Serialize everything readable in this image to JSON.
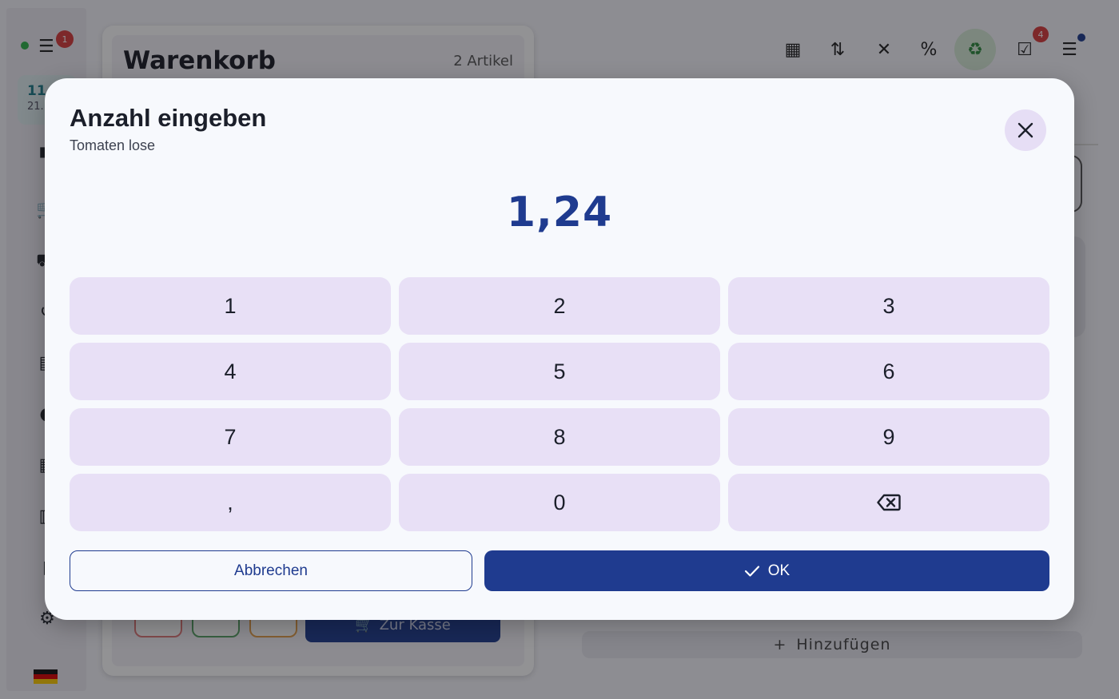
{
  "background": {
    "rail": {
      "menu_badge": "1",
      "time": "11",
      "date": "21.",
      "nav_icons": [
        "dashboard-icon",
        "cart-icon",
        "scooter-icon",
        "history-icon",
        "store-icon",
        "person-icon",
        "calendar-icon",
        "receipt-icon",
        "report-icon",
        "gear-icon"
      ]
    },
    "cart": {
      "title": "Warenkorb",
      "count": "2 Artikel",
      "checkout_label": "Zur Kasse"
    },
    "toolbar": {
      "tasks_badge": "4"
    },
    "add_label": "Hinzufügen"
  },
  "dialog": {
    "title": "Anzahl eingeben",
    "subtitle": "Tomaten lose",
    "value": "1,24",
    "keys": [
      "1",
      "2",
      "3",
      "4",
      "5",
      "6",
      "7",
      "8",
      "9",
      ",",
      "0"
    ],
    "backspace_icon": "backspace-icon",
    "cancel_label": "Abbrechen",
    "ok_label": "OK"
  },
  "colors": {
    "primary": "#1f3b8f",
    "key_bg": "#e8e0f6",
    "dialog_bg": "#f7f9fd",
    "badge": "#d93b3b",
    "online": "#2fb34a"
  }
}
